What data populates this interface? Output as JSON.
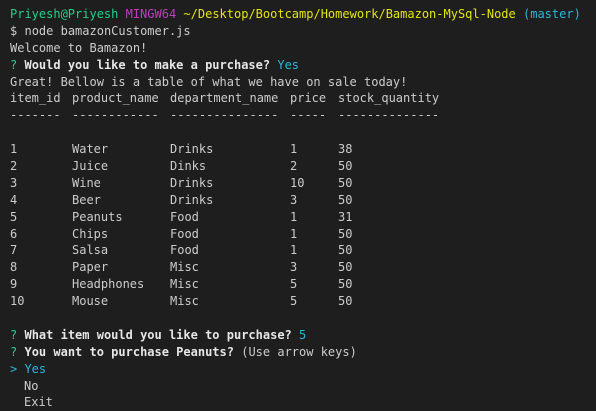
{
  "prompt": {
    "user_host": "Priyesh@Priyesh",
    "system": "MINGW64",
    "path": "~/Desktop/Bootcamp/Homework/Bamazon-MySql-Node",
    "branch": "(master)",
    "symbol": "$",
    "command": "node bamazonCustomer.js"
  },
  "welcome": "Welcome to Bamazon!",
  "q1": {
    "mark": "?",
    "text": "Would you like to make a purchase?",
    "answer": "Yes"
  },
  "sale_msg": "Great! Bellow is a table of what we have on sale today!",
  "table": {
    "headers": [
      "item_id",
      "product_name",
      "department_name",
      "price",
      "stock_quantity"
    ],
    "dividers": [
      "-------",
      "------------",
      "---------------",
      "-----",
      "--------------"
    ],
    "rows": [
      [
        "1",
        "Water",
        "Drinks",
        "1",
        "38"
      ],
      [
        "2",
        "Juice",
        "Dinks",
        "2",
        "50"
      ],
      [
        "3",
        "Wine",
        "Drinks",
        "10",
        "50"
      ],
      [
        "4",
        "Beer",
        "Drinks",
        "3",
        "50"
      ],
      [
        "5",
        "Peanuts",
        "Food",
        "1",
        "31"
      ],
      [
        "6",
        "Chips",
        "Food",
        "1",
        "50"
      ],
      [
        "7",
        "Salsa",
        "Food",
        "1",
        "50"
      ],
      [
        "8",
        "Paper",
        "Misc",
        "3",
        "50"
      ],
      [
        "9",
        "Headphones",
        "Misc",
        "5",
        "50"
      ],
      [
        "10",
        "Mouse",
        "Misc",
        "5",
        "50"
      ]
    ]
  },
  "q2": {
    "mark": "?",
    "text": "What item would you like to purchase?",
    "answer": "5"
  },
  "q3": {
    "mark": "?",
    "text": "You want to purchase Peanuts?",
    "hint": "(Use arrow keys)"
  },
  "choices": {
    "pointer": ">",
    "items": [
      "Yes",
      "No",
      "Exit"
    ],
    "selected": 0
  },
  "colors": {
    "background": "#1e1e1e",
    "green": "#23d18b",
    "purple": "#bc3fbc",
    "yellow": "#e5e510",
    "cyan": "#29b8db"
  }
}
